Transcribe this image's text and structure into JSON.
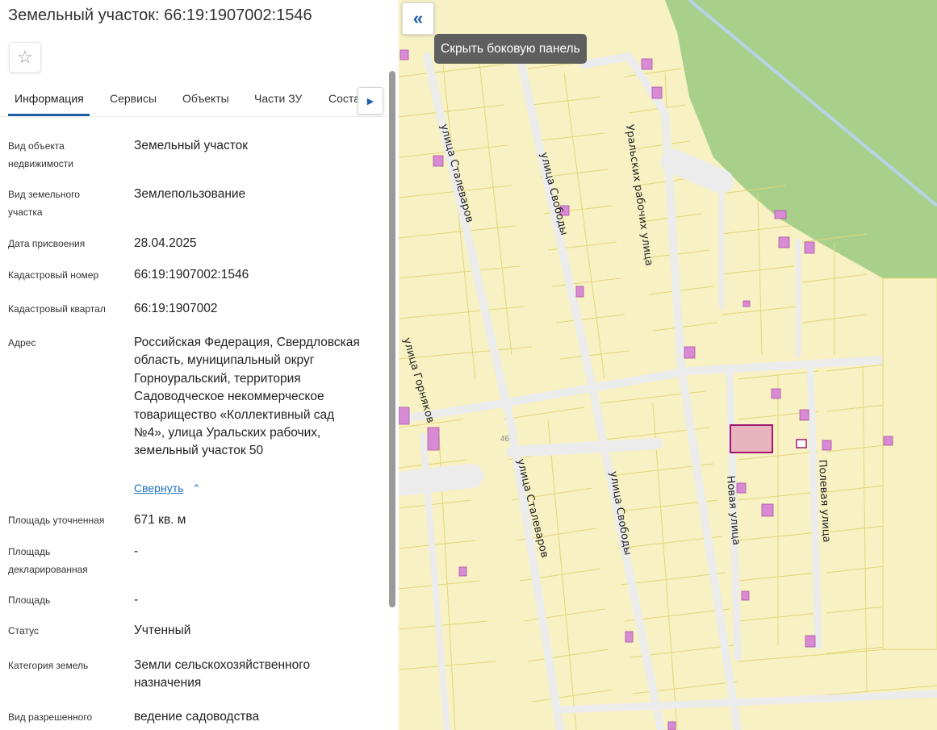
{
  "header": {
    "title": "Земельный участок: 66:19:1907002:1546"
  },
  "favorite": {
    "icon": "star-outline-icon"
  },
  "tabs": [
    {
      "label": "Информация",
      "active": true
    },
    {
      "label": "Сервисы"
    },
    {
      "label": "Объекты"
    },
    {
      "label": "Части ЗУ"
    },
    {
      "label": "Соста"
    }
  ],
  "tab_scroll": {
    "icon": "chevron-right-icon"
  },
  "fields": [
    {
      "label": "Вид объекта недвижимости",
      "value": "Земельный участок"
    },
    {
      "label": "Вид земельного участка",
      "value": "Землепользование"
    },
    {
      "label": "Дата присвоения",
      "value": "28.04.2025"
    },
    {
      "label": "Кадастровый номер",
      "value": "66:19:1907002:1546"
    },
    {
      "label": "Кадастровый квартал",
      "value": "66:19:1907002"
    },
    {
      "label": "Адрес",
      "value": "Российская Федерация, Свердловская область, муниципальный округ Горноуральский, территория Садоводческое некоммерческое товарищество «Коллективный сад №4», улица Уральских рабочих, земельный участок 50"
    },
    {
      "label": "Площадь уточненная",
      "value": "671 кв. м"
    },
    {
      "label": "Площадь декларированная",
      "value": "-"
    },
    {
      "label": "Площадь",
      "value": "-"
    },
    {
      "label": "Статус",
      "value": "Учтенный"
    },
    {
      "label": "Категория земель",
      "value": "Земли сельскохозяйственного назначения"
    },
    {
      "label": "Вид разрешенного",
      "value": "ведение садоводства"
    }
  ],
  "address_collapse": {
    "label": "Свернуть",
    "icon": "chevron-up-icon"
  },
  "map": {
    "toggle_icon": "double-chevron-left-icon",
    "tooltip": "Скрыть боковую панель",
    "streets": {
      "stalevarov_1": "улица Сталеваров",
      "svobody_1": "улица Свободы",
      "uralskikh": "Уральских рабочих улица",
      "gornyakov": "улица Горняков",
      "stalevarov_2": "улица Сталеваров",
      "svobody_2": "улица Свободы",
      "novaya": "Новая улица",
      "polevaya": "Полевая улица"
    },
    "parcel_number": "46",
    "colors": {
      "parcel_fill": "#f7f1c4",
      "parcel_border": "#e3d677",
      "forest": "#a9d08a",
      "building": "#d98ad4",
      "selected": "#e8b4bd",
      "selected_border": "#a01870",
      "road": "#ececec"
    }
  }
}
